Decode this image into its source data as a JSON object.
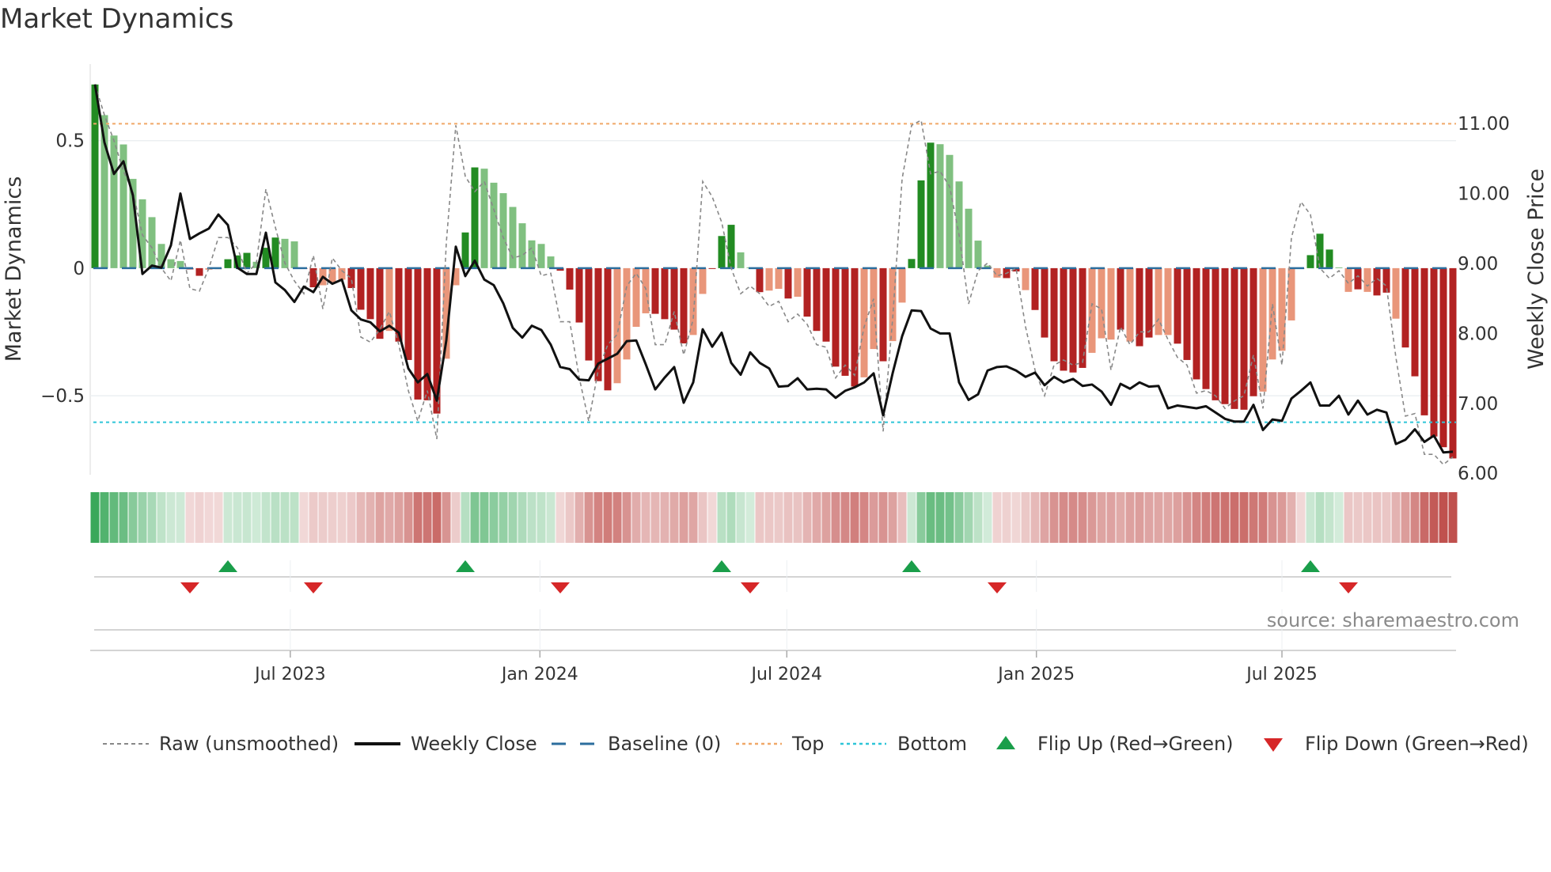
{
  "title": "Market Dynamics",
  "source": "source: sharemaestro.com",
  "colors": {
    "green_strong": "#228b22",
    "green_light": "#80c080",
    "red_strong": "#b22222",
    "red_light": "#e9967a",
    "baseline": "#2c6e9e",
    "top": "#f0a868",
    "bottom": "#2ec5d8",
    "raw": "#888888",
    "close": "#111111",
    "flip_up": "#1a9e4a",
    "flip_down": "#d62728",
    "strip_green": "#3aa85a",
    "strip_red": "#c0504d"
  },
  "chart_data": {
    "type": "bar",
    "title": "Market Dynamics",
    "xlabel": "",
    "ylabel": "Market Dynamics",
    "ylabel_right": "Weekly Close Price",
    "start_date": "2023-02-07",
    "interval_days": 7,
    "ylim": [
      -0.81,
      0.8
    ],
    "ylim_right": [
      5.98,
      11.85
    ],
    "yticks": [
      {
        "value": 0.5,
        "label": "0.5"
      },
      {
        "value": 0,
        "label": "0"
      },
      {
        "value": -0.5,
        "label": "−0.5"
      }
    ],
    "yticks_right": [
      {
        "value": 11,
        "label": "11.00"
      },
      {
        "value": 10,
        "label": "10.00"
      },
      {
        "value": 9,
        "label": "9.00"
      },
      {
        "value": 8,
        "label": "8.00"
      },
      {
        "value": 7,
        "label": "7.00"
      },
      {
        "value": 6,
        "label": "6.00"
      }
    ],
    "xticks": [
      {
        "date": "2023-07-01",
        "label": "Jul 2023"
      },
      {
        "date": "2024-01-01",
        "label": "Jan 2024"
      },
      {
        "date": "2024-07-01",
        "label": "Jul 2024"
      },
      {
        "date": "2025-01-01",
        "label": "Jan 2025"
      },
      {
        "date": "2025-07-01",
        "label": "Jul 2025"
      }
    ],
    "top_level": 0.566,
    "bottom_level": -0.604,
    "baseline": 0,
    "momentum": [
      0.72,
      0.6,
      0.52,
      0.485,
      0.35,
      0.27,
      0.2,
      0.095,
      0.035,
      0.028,
      -0.005,
      -0.03,
      -0.006,
      -0.004,
      0.035,
      0.05,
      0.06,
      0.025,
      0.08,
      0.12,
      0.115,
      0.105,
      -0.003,
      -0.075,
      -0.067,
      -0.055,
      -0.045,
      -0.078,
      -0.163,
      -0.2,
      -0.277,
      -0.246,
      -0.288,
      -0.36,
      -0.515,
      -0.518,
      -0.57,
      -0.355,
      -0.067,
      0.14,
      0.395,
      0.39,
      0.335,
      0.294,
      0.24,
      0.176,
      0.109,
      0.095,
      0.046,
      -0.01,
      -0.084,
      -0.213,
      -0.362,
      -0.443,
      -0.479,
      -0.451,
      -0.358,
      -0.23,
      -0.177,
      -0.179,
      -0.2,
      -0.241,
      -0.295,
      -0.262,
      -0.101,
      -0.003,
      0.126,
      0.17,
      0.062,
      0.003,
      -0.094,
      -0.088,
      -0.081,
      -0.119,
      -0.112,
      -0.19,
      -0.246,
      -0.288,
      -0.386,
      -0.422,
      -0.464,
      -0.428,
      -0.317,
      -0.365,
      -0.286,
      -0.135,
      0.036,
      0.344,
      0.492,
      0.486,
      0.444,
      0.34,
      0.233,
      0.108,
      0.01,
      -0.037,
      -0.039,
      -0.013,
      -0.086,
      -0.164,
      -0.272,
      -0.365,
      -0.402,
      -0.409,
      -0.391,
      -0.332,
      -0.275,
      -0.28,
      -0.241,
      -0.288,
      -0.306,
      -0.272,
      -0.262,
      -0.262,
      -0.296,
      -0.36,
      -0.436,
      -0.474,
      -0.518,
      -0.533,
      -0.552,
      -0.555,
      -0.502,
      -0.484,
      -0.358,
      -0.324,
      -0.205,
      -0.003,
      0.051,
      0.135,
      0.073,
      0.003,
      -0.093,
      -0.083,
      -0.093,
      -0.107,
      -0.096,
      -0.198,
      -0.311,
      -0.424,
      -0.577,
      -0.66,
      -0.702,
      -0.746
    ],
    "shade": "SLLLLLLLLLSSLLSSSLSSLLSSLLLSSSSLSSSSSLLSSLLLLLLLLSSSSSSLLLLSSSSLLSSSLLSLLSLSSSSSSLLSLLSSSLLLLLLLSSLSSSSSSLLLSLSSLLSSSSSSSSSLLLLLSSSLLSLSSLSSSSSSS",
    "series": [
      {
        "name": "Raw (unsmoothed)",
        "axis": "left",
        "values": [
          0.72,
          0.6,
          0.5,
          0.38,
          0.3,
          0.13,
          0.08,
          0.0,
          -0.05,
          0.11,
          -0.08,
          -0.09,
          0.0,
          0.12,
          0.12,
          0.08,
          -0.02,
          0.02,
          0.31,
          0.16,
          0.02,
          -0.05,
          -0.1,
          0.05,
          -0.16,
          0.04,
          -0.01,
          -0.04,
          -0.27,
          -0.29,
          -0.24,
          -0.17,
          -0.3,
          -0.48,
          -0.6,
          -0.48,
          -0.67,
          0.1,
          0.56,
          0.36,
          0.3,
          0.34,
          0.23,
          0.12,
          0.04,
          0.05,
          0.08,
          -0.03,
          -0.02,
          -0.21,
          -0.21,
          -0.43,
          -0.6,
          -0.4,
          -0.3,
          -0.26,
          -0.07,
          -0.02,
          -0.08,
          -0.3,
          -0.3,
          -0.17,
          -0.34,
          -0.2,
          0.34,
          0.28,
          0.18,
          0.0,
          -0.1,
          -0.07,
          -0.1,
          -0.15,
          -0.13,
          -0.21,
          -0.18,
          -0.22,
          -0.3,
          -0.31,
          -0.43,
          -0.38,
          -0.42,
          -0.23,
          -0.12,
          -0.64,
          -0.2,
          0.35,
          0.56,
          0.58,
          0.37,
          0.38,
          0.32,
          0.13,
          -0.14,
          -0.01,
          0.02,
          -0.03,
          -0.02,
          0.0,
          -0.23,
          -0.4,
          -0.5,
          -0.38,
          -0.36,
          -0.38,
          -0.37,
          -0.14,
          -0.16,
          -0.4,
          -0.23,
          -0.3,
          -0.25,
          -0.25,
          -0.2,
          -0.28,
          -0.35,
          -0.38,
          -0.49,
          -0.48,
          -0.5,
          -0.55,
          -0.52,
          -0.5,
          -0.34,
          -0.55,
          -0.14,
          -0.38,
          0.12,
          0.26,
          0.21,
          0.0,
          -0.04,
          -0.01,
          -0.06,
          -0.03,
          -0.07,
          -0.04,
          -0.07,
          -0.35,
          -0.58,
          -0.57,
          -0.73,
          -0.73,
          -0.77,
          -0.74
        ]
      },
      {
        "name": "Weekly Close",
        "axis": "right",
        "values": [
          11.56,
          10.73,
          10.28,
          10.46,
          9.97,
          8.85,
          8.97,
          8.94,
          9.26,
          10.0,
          9.35,
          9.43,
          9.5,
          9.7,
          9.55,
          8.94,
          8.85,
          8.85,
          9.44,
          8.73,
          8.62,
          8.45,
          8.67,
          8.59,
          8.81,
          8.71,
          8.77,
          8.33,
          8.2,
          8.16,
          8.03,
          8.11,
          8.01,
          7.5,
          7.3,
          7.42,
          7.04,
          7.9,
          9.24,
          8.82,
          9.04,
          8.77,
          8.69,
          8.43,
          8.08,
          7.94,
          8.11,
          8.05,
          7.84,
          7.52,
          7.49,
          7.34,
          7.33,
          7.57,
          7.64,
          7.71,
          7.89,
          7.9,
          7.56,
          7.2,
          7.37,
          7.52,
          7.01,
          7.3,
          8.06,
          7.81,
          8.01,
          7.58,
          7.41,
          7.73,
          7.58,
          7.5,
          7.24,
          7.25,
          7.36,
          7.2,
          7.21,
          7.2,
          7.08,
          7.18,
          7.23,
          7.3,
          7.43,
          6.83,
          7.43,
          7.96,
          8.33,
          8.32,
          8.07,
          8.0,
          8.0,
          7.3,
          7.05,
          7.13,
          7.47,
          7.52,
          7.53,
          7.47,
          7.38,
          7.44,
          7.26,
          7.38,
          7.3,
          7.35,
          7.25,
          7.27,
          7.17,
          6.98,
          7.28,
          7.21,
          7.3,
          7.24,
          7.25,
          6.93,
          6.97,
          6.95,
          6.93,
          6.96,
          6.87,
          6.78,
          6.74,
          6.74,
          6.98,
          6.62,
          6.77,
          6.75,
          7.07,
          7.18,
          7.3,
          6.97,
          6.97,
          7.11,
          6.84,
          7.04,
          6.84,
          6.91,
          6.87,
          6.42,
          6.48,
          6.63,
          6.45,
          6.54,
          6.3,
          6.31
        ]
      }
    ],
    "flip_up_weeks": [
      14,
      39,
      66,
      86,
      128
    ],
    "flip_down_weeks": [
      10,
      23,
      49,
      69,
      95,
      132
    ],
    "legend": {
      "placement": "bottom",
      "items": [
        {
          "key": "raw",
          "label": "Raw (unsmoothed)"
        },
        {
          "key": "close",
          "label": "Weekly Close"
        },
        {
          "key": "baseline",
          "label": "Baseline (0)"
        },
        {
          "key": "top",
          "label": "Top"
        },
        {
          "key": "bottom",
          "label": "Bottom"
        },
        {
          "key": "flip_up",
          "label": "Flip Up (Red→Green)"
        },
        {
          "key": "flip_down",
          "label": "Flip Down (Green→Red)"
        }
      ]
    }
  }
}
